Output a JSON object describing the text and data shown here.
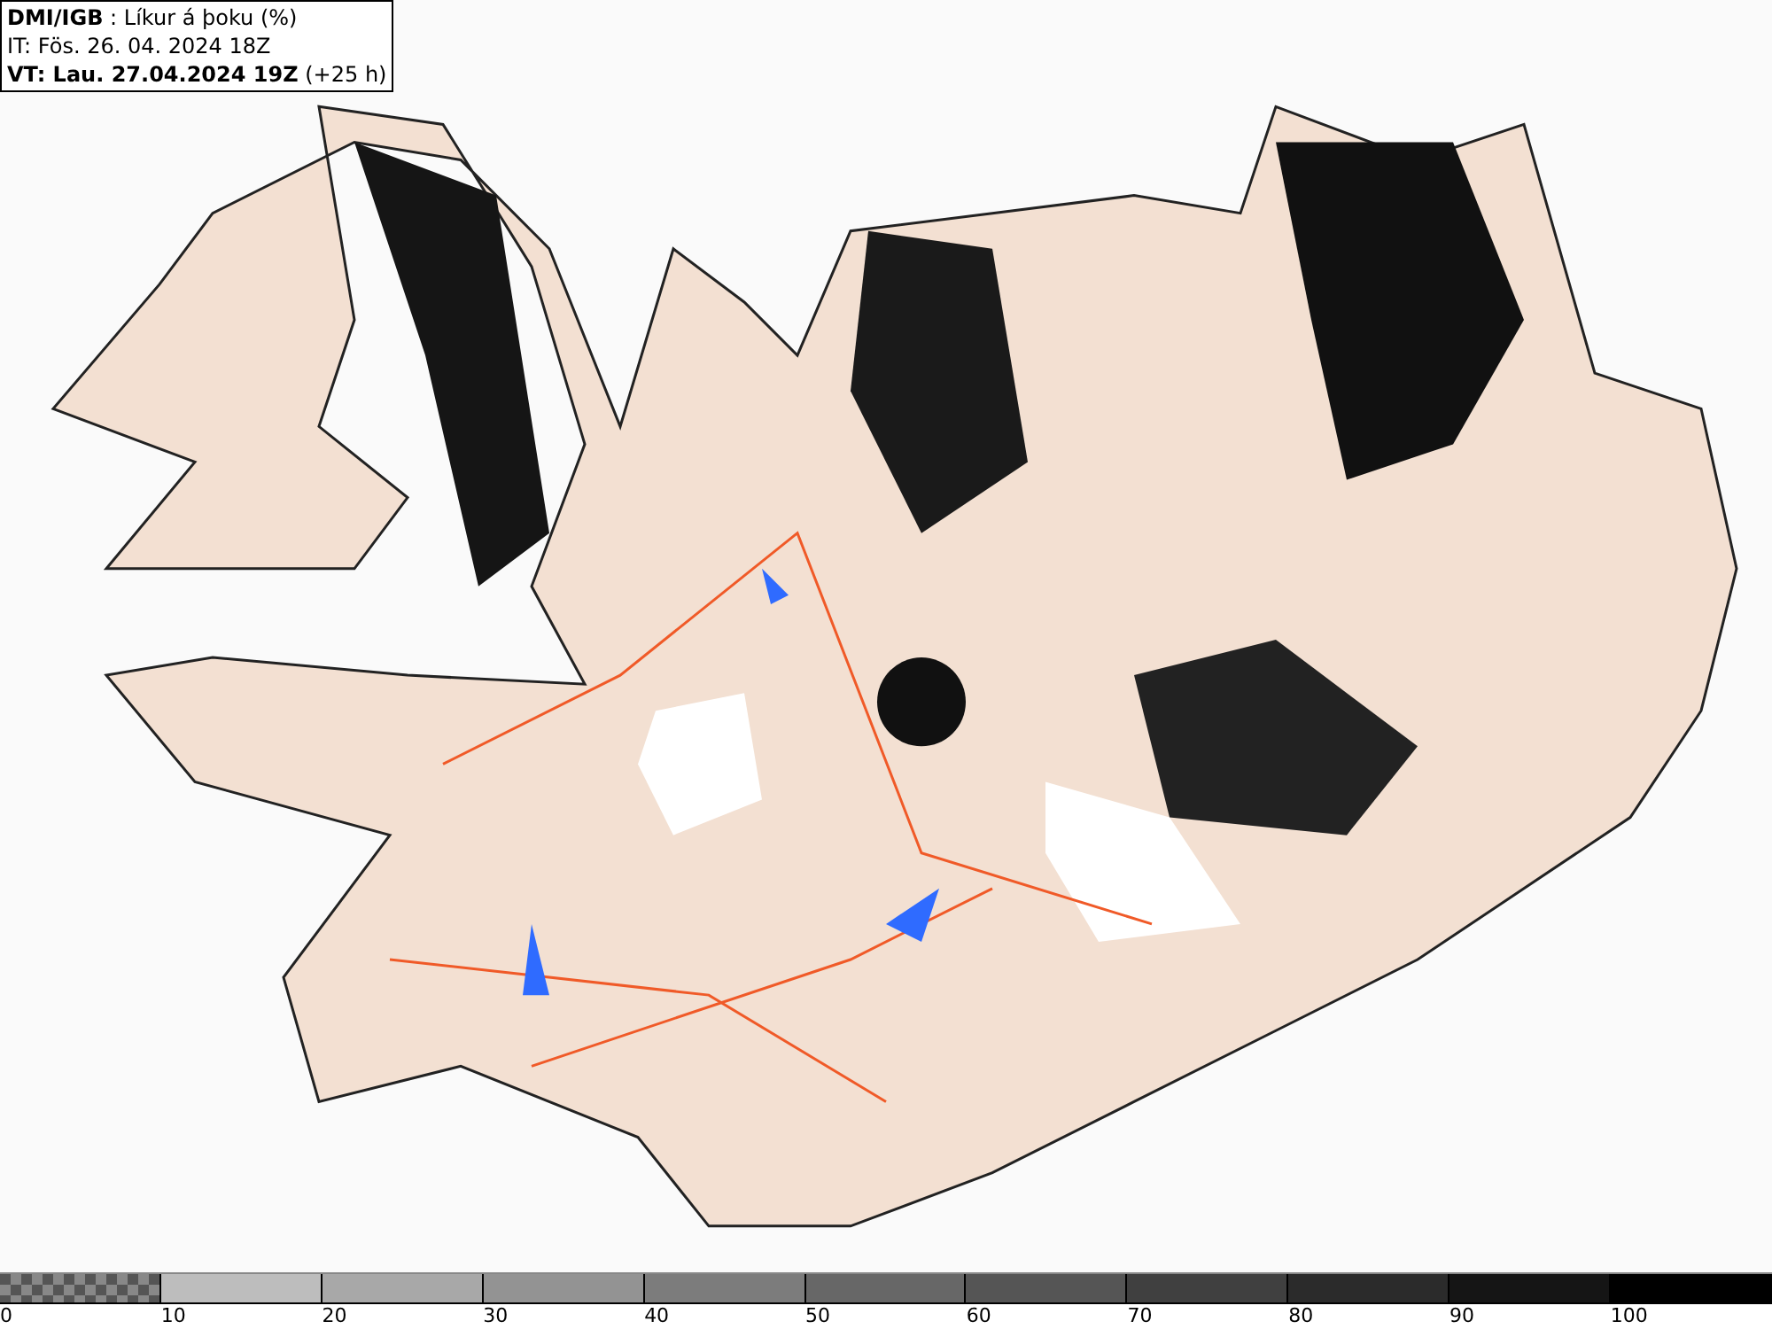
{
  "header": {
    "lines": [
      "**DMI/IGB** : Líkur á þoku (%)",
      "IT: Fös. 26. 04. 2024 18Z",
      "**VT: Lau. 27.04.2024 19Z** (+25 h)"
    ]
  },
  "legend": {
    "segments": [
      {
        "kind": "checker",
        "color": "#555555"
      },
      {
        "kind": "solid",
        "color": "#bdbdbd"
      },
      {
        "kind": "solid",
        "color": "#a8a8a8"
      },
      {
        "kind": "solid",
        "color": "#939393"
      },
      {
        "kind": "solid",
        "color": "#7c7c7c"
      },
      {
        "kind": "solid",
        "color": "#676767"
      },
      {
        "kind": "solid",
        "color": "#555555"
      },
      {
        "kind": "solid",
        "color": "#404040"
      },
      {
        "kind": "solid",
        "color": "#2b2b2b"
      },
      {
        "kind": "solid",
        "color": "#151515"
      },
      {
        "kind": "solid",
        "color": "#000000"
      }
    ],
    "labels": [
      "0",
      "10",
      "20",
      "30",
      "40",
      "50",
      "60",
      "70",
      "80",
      "90",
      "100"
    ]
  }
}
